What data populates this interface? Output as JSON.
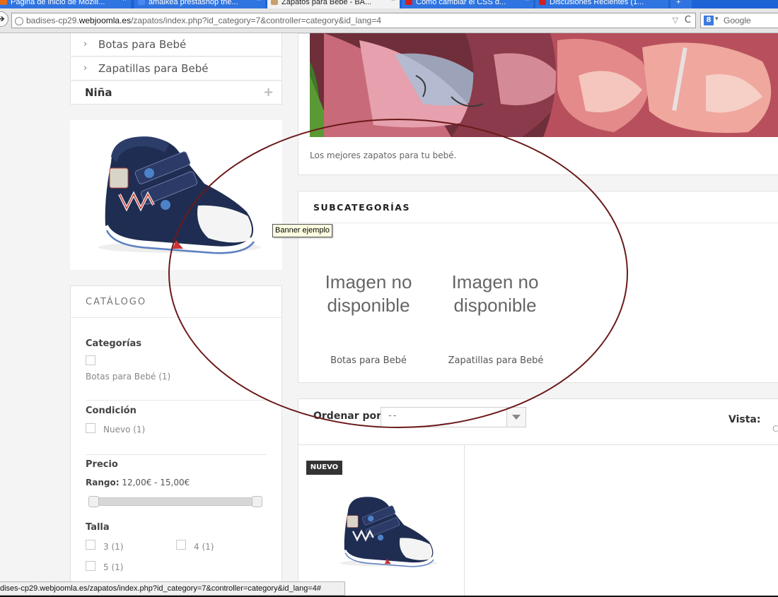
{
  "browser": {
    "tabs": [
      {
        "label": "Página de inicio de Mozill...",
        "active": false
      },
      {
        "label": "ámaikea prestashop the...",
        "active": false
      },
      {
        "label": "Zapatos para Bebé - BA...",
        "active": true
      },
      {
        "label": "Cómo cambiar el CSS d...",
        "active": false
      },
      {
        "label": "Discusiones Recientes (1...",
        "active": false
      }
    ],
    "url_prefix": "badises-cp29.",
    "url_domain": "webjoomla.es",
    "url_path": "/zapatos/index.php?id_category=7&controller=category&id_lang=4",
    "search_engine": "Google",
    "status_url": "dises-cp29.webjoomla.es/zapatos/index.php?id_category=7&controller=category&id_lang=4#"
  },
  "sidebar": {
    "categories": [
      {
        "label": "Botas para Bebé"
      },
      {
        "label": "Zapatillas para Bebé"
      }
    ],
    "nina_label": "Niña",
    "nina_expand": "+"
  },
  "catalog": {
    "title": "CATÁLOGO",
    "categorias": {
      "title": "Categorías",
      "option": "Botas para Bebé (1)"
    },
    "condicion": {
      "title": "Condición",
      "option": "Nuevo (1)"
    },
    "precio": {
      "title": "Precio",
      "range_label": "Rango:",
      "range_value": "12,00€ - 15,00€",
      "min_fraction": 0,
      "max_fraction": 1
    },
    "talla": {
      "title": "Talla",
      "options": [
        "3 (1)",
        "4 (1)",
        "5 (1)"
      ]
    }
  },
  "category": {
    "description": "Los mejores zapatos para tu bebé."
  },
  "subcategories": {
    "title": "SUBCATEGORÍAS",
    "placeholder_line1": "Imagen no",
    "placeholder_line2": "disponible",
    "items": [
      "Botas para Bebé",
      "Zapatillas para Bebé"
    ]
  },
  "tooltip": "Banner ejemplo",
  "sorting": {
    "label": "Ordenar por",
    "selected": "--",
    "view_label": "Vista:",
    "view_next": "C"
  },
  "product": {
    "badge": "NUEVO"
  },
  "colors": {
    "annotation": "#6b1a1a",
    "shoe_navy": "#1f2d52",
    "chrome_blue": "#1e63d6"
  }
}
